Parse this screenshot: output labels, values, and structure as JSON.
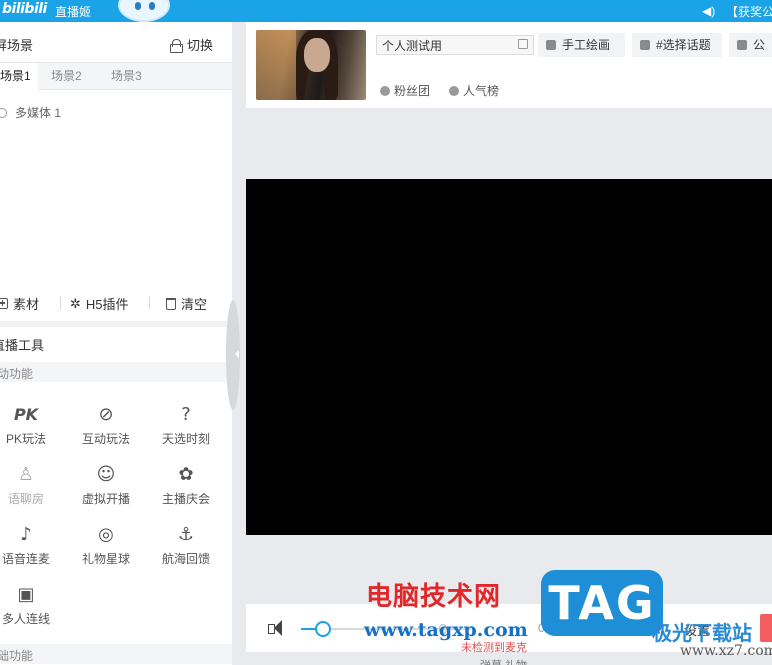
{
  "topbar": {
    "logo": "bilibili",
    "app_title": "直播姬",
    "right_text": "【获奖公"
  },
  "scene_panel": {
    "title": "屏场景",
    "switch_label": "切换",
    "tabs": [
      "场景1",
      "场景2",
      "场景3"
    ],
    "active_tab": 0,
    "sources": [
      "多媒体 1"
    ]
  },
  "tools_row": {
    "material_label": "素材",
    "h5_label": "H5插件",
    "clear_label": "清空"
  },
  "live_tools": {
    "title": "直播工具",
    "section_interactive": "动功能",
    "items": [
      {
        "icon": "PK",
        "label": "PK玩法",
        "disabled": false
      },
      {
        "icon": "⊘",
        "label": "互动玩法",
        "disabled": false
      },
      {
        "icon": "?",
        "label": "天选时刻",
        "disabled": false
      },
      {
        "icon": "♙",
        "label": "语聊房",
        "disabled": true
      },
      {
        "icon": "☺",
        "label": "虚拟开播",
        "disabled": false
      },
      {
        "icon": "✿",
        "label": "主播庆会",
        "disabled": false
      },
      {
        "icon": "♪",
        "label": "语音连麦",
        "disabled": false
      },
      {
        "icon": "◎",
        "label": "礼物星球",
        "disabled": false
      },
      {
        "icon": "⚓",
        "label": "航海回馈",
        "disabled": false
      },
      {
        "icon": "▣",
        "label": "多人连线",
        "disabled": false
      }
    ],
    "section_basic": "础功能"
  },
  "room": {
    "title_value": "个人测试用",
    "chips": [
      "手工绘画",
      "#选择话题",
      "公"
    ],
    "badges": [
      "粉丝团",
      "人气榜"
    ]
  },
  "controls": {
    "volume_level": 0.13,
    "volume_percent": "0%",
    "settings_label": "设置",
    "warning_text": "未检测到麦克",
    "below_text": "弹幕    礼物"
  },
  "watermark": {
    "cn": "电脑技术网",
    "url": "www.tagxp.com",
    "tag": "TAG",
    "site": "极光下载站",
    "domain": "www.xz7.com"
  },
  "colors": {
    "accent": "#1aa3e6",
    "live_red": "#f25d5d",
    "watermark_red": "#e0282a",
    "watermark_blue": "#1e8fd6"
  }
}
